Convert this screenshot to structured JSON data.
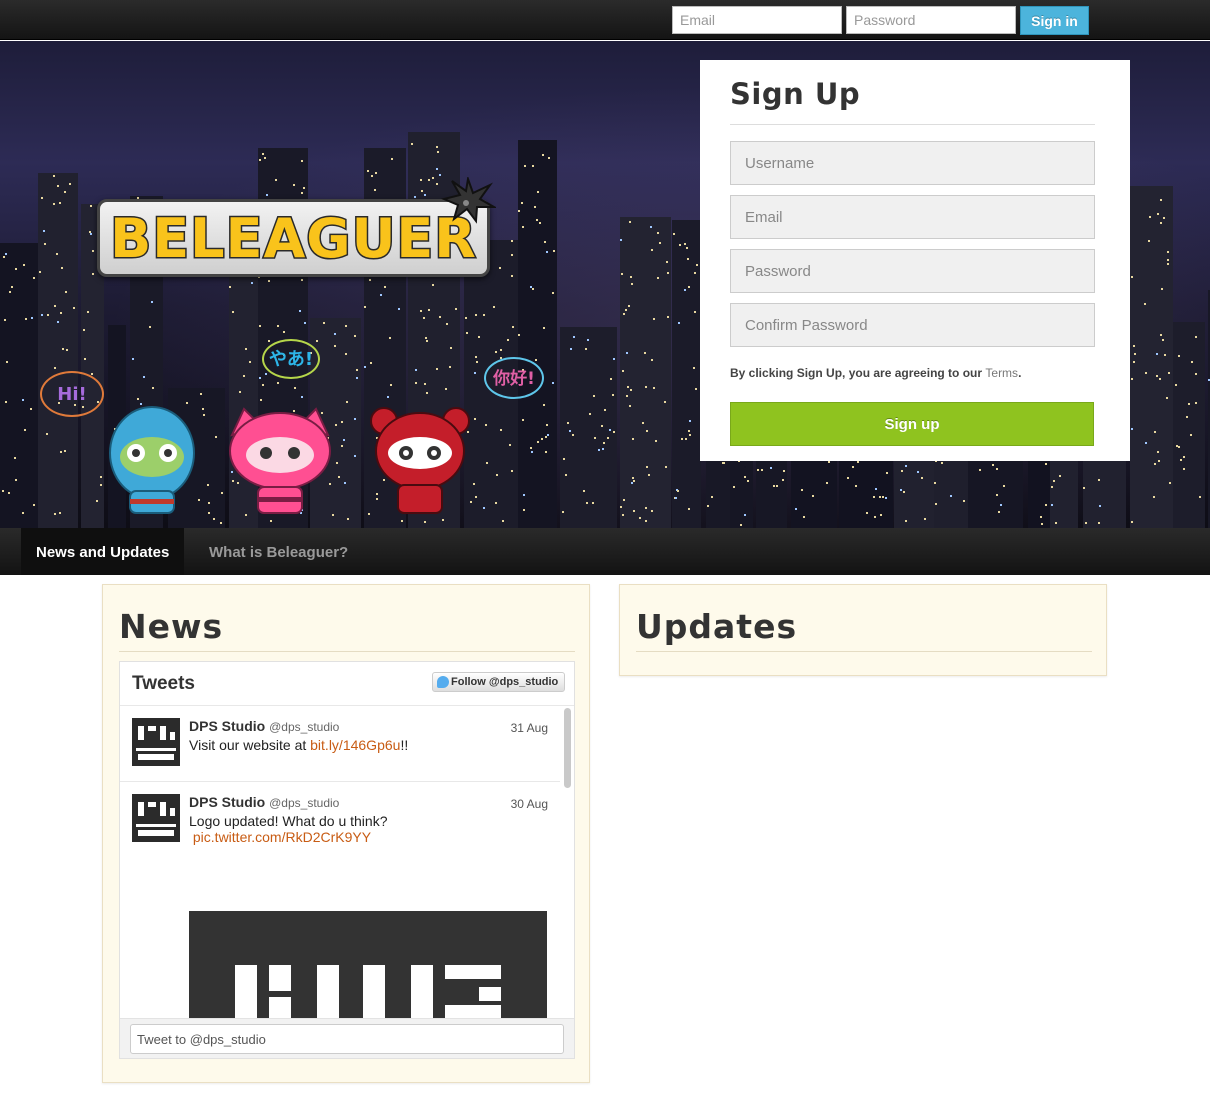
{
  "topbar": {
    "email_placeholder": "Email",
    "password_placeholder": "Password",
    "signin_label": "Sign in"
  },
  "hero": {
    "logo_text": "BELEAGUER",
    "bubbles": [
      "Hi!",
      "やあ!",
      "你好!"
    ]
  },
  "signup": {
    "title": "Sign Up",
    "username_placeholder": "Username",
    "email_placeholder": "Email",
    "password_placeholder": "Password",
    "confirm_placeholder": "Confirm Password",
    "terms_prefix": "By clicking Sign Up, you are agreeing to our ",
    "terms_link": "Terms",
    "terms_suffix": ".",
    "button_label": "Sign up"
  },
  "nav": {
    "items": [
      {
        "label": "News and Updates",
        "active": true
      },
      {
        "label": "What is Beleaguer?",
        "active": false
      }
    ]
  },
  "news": {
    "title": "News",
    "widget": {
      "title": "Tweets",
      "follow_label": "Follow @dps_studio",
      "tweets": [
        {
          "name": "DPS Studio",
          "handle": "@dps_studio",
          "date": "31 Aug",
          "text_prefix": "Visit our website at ",
          "link": "bit.ly/146Gp6u",
          "text_suffix": "!!"
        },
        {
          "name": "DPS Studio",
          "handle": "@dps_studio",
          "date": "30 Aug",
          "text_prefix": "Logo updated! What do u think?",
          "link": "pic.twitter.com/RkD2CrK9YY",
          "text_suffix": ""
        }
      ],
      "compose_placeholder": "Tweet to @dps_studio"
    }
  },
  "updates": {
    "title": "Updates"
  },
  "colors": {
    "signin_button": "#4cb4dc",
    "signup_button": "#8fc31f",
    "logo_yellow": "#f9c31b",
    "panel_background": "#fefaeb",
    "link_orange": "#c85c14",
    "navbar": "#1a1a1a"
  }
}
